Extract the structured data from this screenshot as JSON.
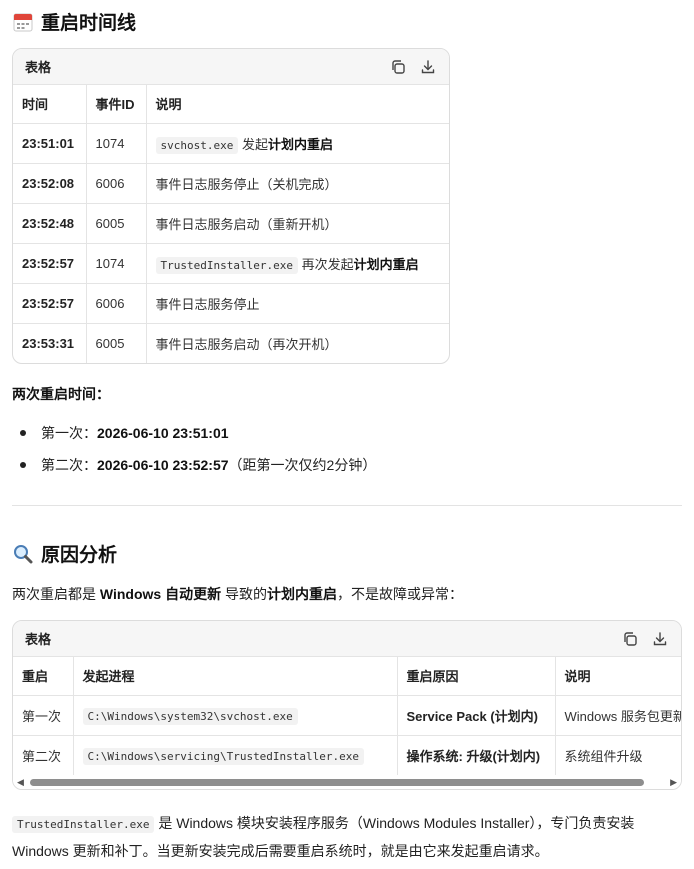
{
  "section1": {
    "heading": "重启时间线",
    "icon": "calendar-icon"
  },
  "table1": {
    "card_title": "表格",
    "copy_icon": "copy-icon",
    "download_icon": "download-icon",
    "headers": [
      "时间",
      "事件ID",
      "说明"
    ],
    "rows": [
      {
        "time": "23:51:01",
        "id": "1074",
        "code": "svchost.exe",
        "pre": " 发起",
        "bold": "计划内重启",
        "text": ""
      },
      {
        "time": "23:52:08",
        "id": "6006",
        "code": "",
        "pre": "",
        "bold": "",
        "text": "事件日志服务停止（关机完成）"
      },
      {
        "time": "23:52:48",
        "id": "6005",
        "code": "",
        "pre": "",
        "bold": "",
        "text": "事件日志服务启动（重新开机）"
      },
      {
        "time": "23:52:57",
        "id": "1074",
        "code": "TrustedInstaller.exe",
        "pre": " 再次发起",
        "bold": "计划内重启",
        "text": ""
      },
      {
        "time": "23:52:57",
        "id": "6006",
        "code": "",
        "pre": "",
        "bold": "",
        "text": "事件日志服务停止"
      },
      {
        "time": "23:53:31",
        "id": "6005",
        "code": "",
        "pre": "",
        "bold": "",
        "text": "事件日志服务启动（再次开机）"
      }
    ]
  },
  "restart_times": {
    "label": "两次重启时间：",
    "items": [
      {
        "prefix": "第一次：",
        "value": "2026-06-10 23:51:01",
        "suffix": ""
      },
      {
        "prefix": "第二次：",
        "value": "2026-06-10 23:52:57",
        "suffix": "（距第一次仅约2分钟）"
      }
    ]
  },
  "section2": {
    "heading": "原因分析",
    "icon": "magnifier-icon"
  },
  "cause": {
    "t1": "两次重启都是 ",
    "b1": "Windows 自动更新",
    "t2": " 导致的",
    "b2": "计划内重启",
    "t3": "，不是故障或异常："
  },
  "table2": {
    "card_title": "表格",
    "copy_icon": "copy-icon",
    "download_icon": "download-icon",
    "headers": [
      "重启",
      "发起进程",
      "重启原因",
      "说明"
    ],
    "rows": [
      {
        "n": "第一次",
        "proc": "C:\\Windows\\system32\\svchost.exe",
        "reason": "Service Pack (计划内)",
        "desc": "Windows 服务包更新"
      },
      {
        "n": "第二次",
        "proc": "C:\\Windows\\servicing\\TrustedInstaller.exe",
        "reason": "操作系统: 升级(计划内)",
        "desc": "系统组件升级"
      }
    ]
  },
  "note": {
    "code": "TrustedInstaller.exe",
    "text1": " 是 Windows 模块安装程序服务（Windows Modules Installer），专门负责安装",
    "text2": "Windows 更新和补丁。当更新安装完成后需要重启系统时，就是由它来发起重启请求。"
  }
}
